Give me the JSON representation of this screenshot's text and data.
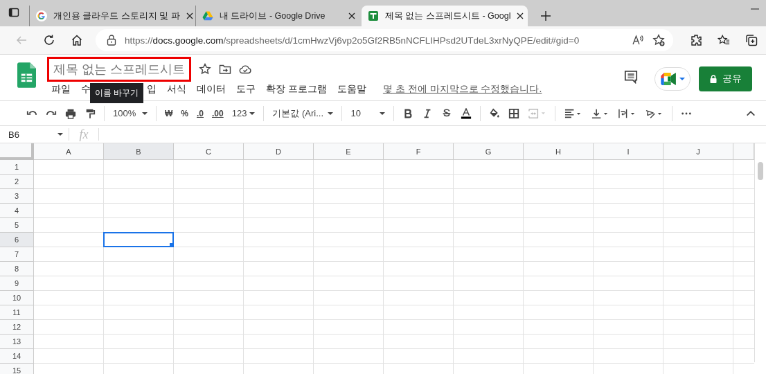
{
  "browser": {
    "tabs": [
      {
        "kind": "google",
        "title": "개인용 클라우드 스토리지 및 파",
        "selected": false
      },
      {
        "kind": "drive",
        "title": "내 드라이브 - Google Drive",
        "selected": false
      },
      {
        "kind": "sheets",
        "title": "제목 없는 스프레드시트 - Googl",
        "selected": true
      }
    ],
    "back_disabled": true,
    "address": {
      "scheme": "https://",
      "host": "docs.google.com",
      "path": "/spreadsheets/d/1cmHwzVj6vp2o5Gf2RB5nNCFLIHPsd2UTdeL3xrNyQPE/edit#gid=0"
    }
  },
  "doc": {
    "title": "제목 없는 스프레드시트",
    "title_highlighted": true,
    "tooltip": "이름 바꾸기",
    "menu": [
      "파일",
      "수",
      "입",
      "서식",
      "데이터",
      "도구",
      "확장 프로그램",
      "도움말"
    ],
    "last_edit": "몇 초 전에 마지막으로 수정했습니다.",
    "share": "공유"
  },
  "toolbar": {
    "zoom": "100%",
    "currency": "₩",
    "percent": "%",
    "decrease_decimal": ".0",
    "increase_decimal": ".00",
    "number_format": "123",
    "font": "기본값 (Ari...",
    "font_size": "10",
    "merge_disabled": true
  },
  "formula_bar": {
    "cell_ref": "B6",
    "fx": "fx"
  },
  "sheet": {
    "columns": [
      {
        "label": "A",
        "selected": false
      },
      {
        "label": "B",
        "selected": true
      },
      {
        "label": "C",
        "selected": false
      },
      {
        "label": "D",
        "selected": false
      },
      {
        "label": "E",
        "selected": false
      },
      {
        "label": "F",
        "selected": false
      },
      {
        "label": "G",
        "selected": false
      },
      {
        "label": "H",
        "selected": false
      },
      {
        "label": "I",
        "selected": false
      },
      {
        "label": "J",
        "selected": false
      }
    ],
    "rows": [
      {
        "label": "1",
        "selected": false
      },
      {
        "label": "2",
        "selected": false
      },
      {
        "label": "3",
        "selected": false
      },
      {
        "label": "4",
        "selected": false
      },
      {
        "label": "5",
        "selected": false
      },
      {
        "label": "6",
        "selected": true
      },
      {
        "label": "7",
        "selected": false
      },
      {
        "label": "8",
        "selected": false
      },
      {
        "label": "9",
        "selected": false
      },
      {
        "label": "10",
        "selected": false
      },
      {
        "label": "11",
        "selected": false
      },
      {
        "label": "12",
        "selected": false
      },
      {
        "label": "13",
        "selected": false
      },
      {
        "label": "14",
        "selected": false
      },
      {
        "label": "15",
        "selected": false
      }
    ]
  }
}
